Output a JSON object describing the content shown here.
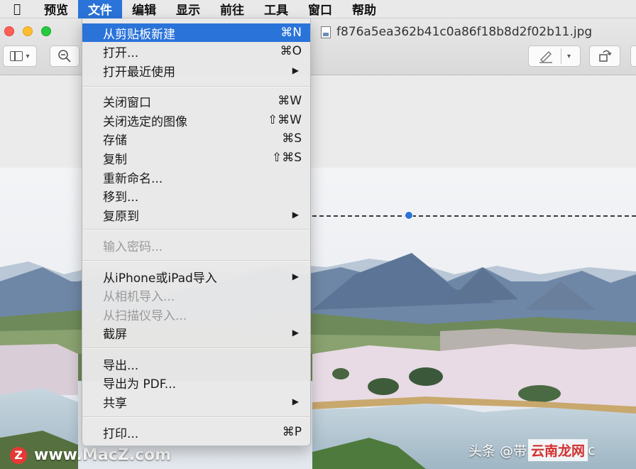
{
  "menubar": {
    "apple": "",
    "items": [
      "预览",
      "文件",
      "编辑",
      "显示",
      "前往",
      "工具",
      "窗口",
      "帮助"
    ],
    "active_index": 1
  },
  "window": {
    "doc_title": "f876a5ea362b41c0a86f18b8d2f02b11.jpg"
  },
  "toolbar": {
    "sidebar_icon": "sidebar-icon",
    "zoom_icon": "zoom-out-icon",
    "markup_icon": "pen-icon",
    "rotate_icon": "rotate-icon"
  },
  "file_menu": {
    "group1": [
      {
        "label": "从剪贴板新建",
        "shortcut": "⌘N"
      },
      {
        "label": "打开...",
        "shortcut": "⌘O"
      },
      {
        "label": "打开最近使用",
        "shortcut": "▶"
      }
    ],
    "group2": [
      {
        "label": "关闭窗口",
        "shortcut": "⌘W"
      },
      {
        "label": "关闭选定的图像",
        "shortcut": "⇧⌘W"
      },
      {
        "label": "存储",
        "shortcut": "⌘S"
      },
      {
        "label": "复制",
        "shortcut": "⇧⌘S"
      },
      {
        "label": "重新命名...",
        "shortcut": ""
      },
      {
        "label": "移到...",
        "shortcut": ""
      },
      {
        "label": "复原到",
        "shortcut": "▶"
      }
    ],
    "group3": [
      {
        "label": "输入密码...",
        "shortcut": ""
      }
    ],
    "group4": [
      {
        "label": "从iPhone或iPad导入",
        "shortcut": "▶"
      },
      {
        "label": "从相机导入...",
        "shortcut": ""
      },
      {
        "label": "从扫描仪导入...",
        "shortcut": ""
      },
      {
        "label": "截屏",
        "shortcut": "▶"
      }
    ],
    "group5": [
      {
        "label": "导出...",
        "shortcut": ""
      },
      {
        "label": "导出为 PDF...",
        "shortcut": ""
      },
      {
        "label": "共享",
        "shortcut": "▶"
      }
    ],
    "group6": [
      {
        "label": "打印...",
        "shortcut": "⌘P"
      }
    ]
  },
  "watermarks": {
    "left_badge": "Z",
    "left_text": "www.MacZ.com",
    "right_prefix": "头条 @带",
    "right_brand": "云南龙网",
    "right_suffix": "c"
  },
  "colors": {
    "accent": "#2a73d9",
    "sky": "#f2f3f5",
    "blossom": "#e9dbe6",
    "water": "#b9cbd6"
  }
}
